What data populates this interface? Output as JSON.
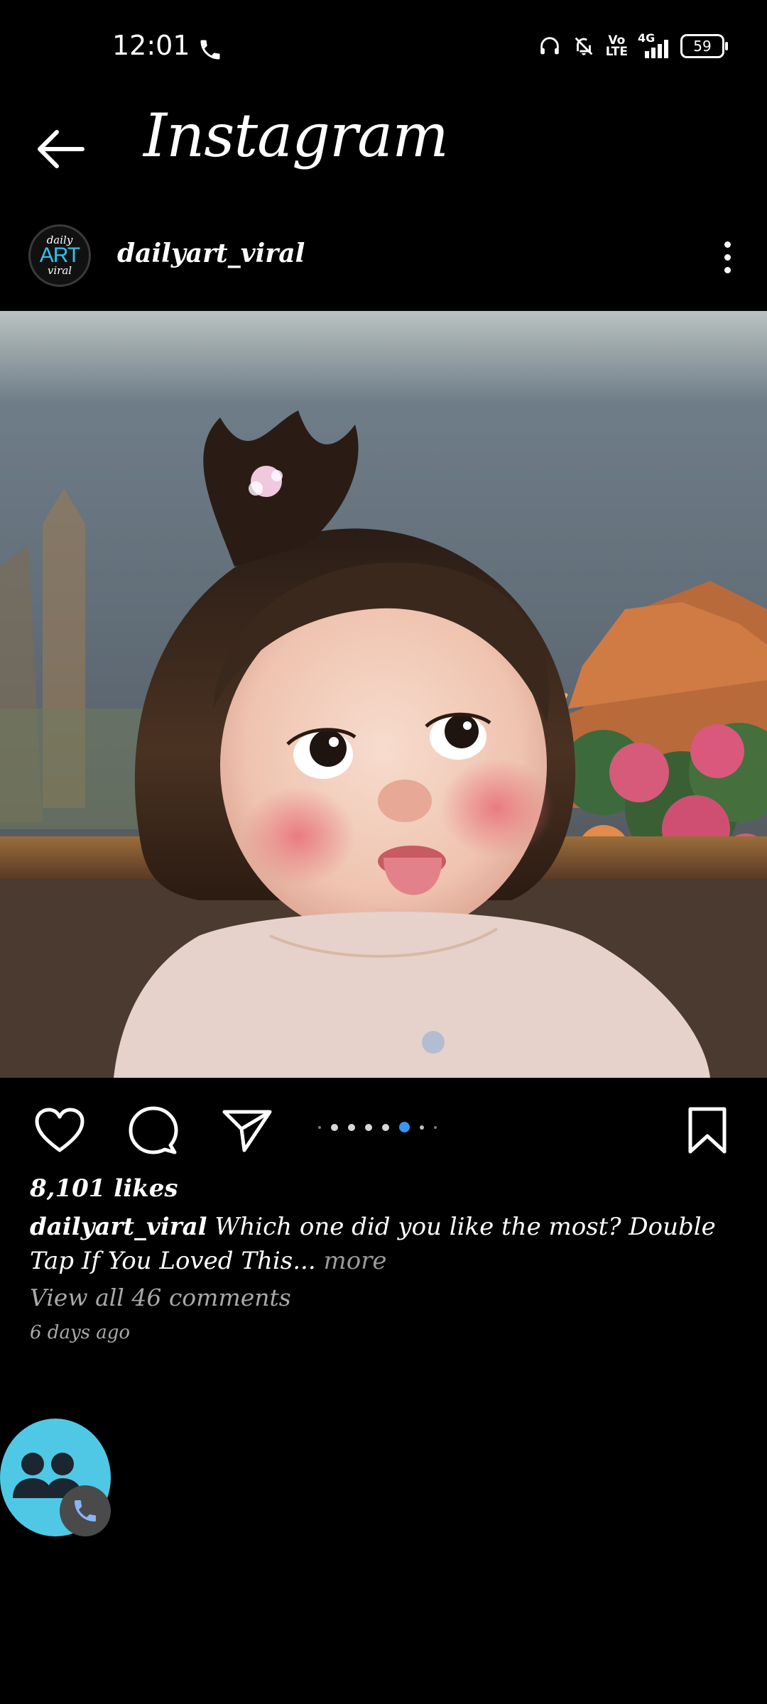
{
  "status_bar": {
    "time": "12:01",
    "network": "4G",
    "volte": "Vo\nLTE",
    "battery": "59",
    "icons": [
      "phone-call-icon",
      "headphones-icon",
      "muted-bell-icon",
      "volte-icon",
      "signal-4g-icon",
      "battery-icon"
    ]
  },
  "header": {
    "title": "Instagram",
    "back_icon": "back-arrow-icon"
  },
  "post": {
    "avatar": {
      "line1": "daily",
      "line2": "ART",
      "line3": "viral"
    },
    "username": "dailyart_viral",
    "more_icon": "more-vertical-icon",
    "image_alt": "Painting of a baby girl with a ponytail sticking out her tongue, pink roses and a temple roof in the background",
    "carousel": {
      "total": 8,
      "active_index": 5
    },
    "likes": "8,101 likes",
    "caption_user": "dailyart_viral",
    "caption_text": " Which one did you like the most? Double Tap If You Loved This...",
    "caption_more": " more",
    "comments": "View all 46 comments",
    "time_ago": "6 days ago"
  },
  "actions": [
    "like-heart-icon",
    "comment-bubble-icon",
    "share-send-icon",
    "bookmark-icon"
  ],
  "colors": {
    "background": "#000000",
    "accent_blue": "#3897f0",
    "call_bubble": "#4fc8e6",
    "secondary_text": "#a8a8a8"
  }
}
